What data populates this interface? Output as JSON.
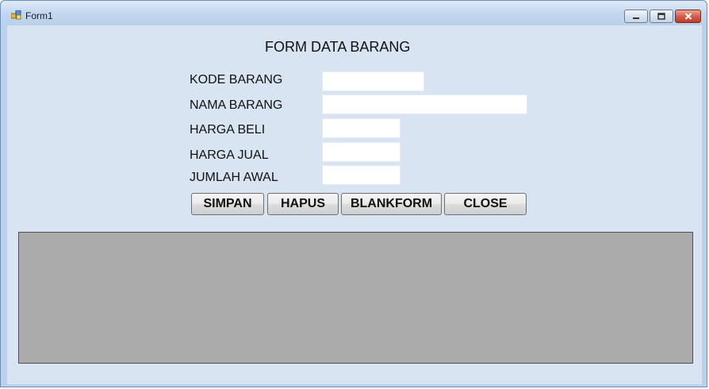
{
  "window": {
    "title": "Form1",
    "minimize_icon": "minimize-icon",
    "maximize_icon": "maximize-icon",
    "close_icon": "close-icon",
    "app_icon": "form-app-icon"
  },
  "form": {
    "heading": "FORM DATA BARANG",
    "fields": [
      {
        "label": "KODE BARANG",
        "value": ""
      },
      {
        "label": "NAMA BARANG",
        "value": ""
      },
      {
        "label": "HARGA BELI",
        "value": ""
      },
      {
        "label": "HARGA JUAL",
        "value": ""
      },
      {
        "label": "JUMLAH AWAL",
        "value": ""
      }
    ],
    "buttons": {
      "simpan": "SIMPAN",
      "hapus": "HAPUS",
      "blankform": "BLANKFORM",
      "close": "CLOSE"
    }
  },
  "colors": {
    "frame": "#b9d1ea",
    "client": "#d8e4f1",
    "grid_background": "#ababab",
    "close_button": "#c0392b"
  }
}
